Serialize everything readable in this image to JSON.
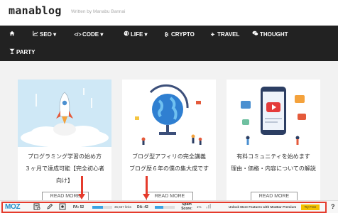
{
  "site": {
    "logo": "manablog",
    "tagline": "Written by Manabu Bannai"
  },
  "nav": {
    "items": [
      {
        "icon": "home-icon",
        "label": ""
      },
      {
        "icon": "chart-icon",
        "label": "SEO ▾"
      },
      {
        "icon": "code-icon",
        "label": "CODE ▾"
      },
      {
        "icon": "globe-icon",
        "label": "LIFE ▾"
      },
      {
        "icon": "bitcoin-icon",
        "label": "CRYPTO"
      },
      {
        "icon": "plane-icon",
        "label": "TRAVEL"
      },
      {
        "icon": "chat-icon",
        "label": "THOUGHT"
      },
      {
        "icon": "cocktail-icon",
        "label": "PARTY"
      }
    ]
  },
  "cards": [
    {
      "line1": "プログラミング学習の始め方",
      "line2": "３ヶ月で達成可能【完全初心者",
      "line3": "向け】",
      "more": "READ MORE",
      "thumb": "rocket-illustration"
    },
    {
      "line1": "ブログ型アフィリの完全講義",
      "line2": "ブログ歴６年の僕の集大成です",
      "line3": "",
      "more": "READ MORE",
      "thumb": "globe-illustration"
    },
    {
      "line1": "有料コミュニティを始めます",
      "line2": "理由・価格・内容についての解説",
      "line3": "",
      "more": "READ MORE",
      "thumb": "smartphone-video-illustration"
    }
  ],
  "mozbar": {
    "logo": "MOZ",
    "pa_label": "PA: 52",
    "pa_value": 52,
    "links": "36,557 links",
    "da_label": "DA: 42",
    "da_value": 42,
    "spam_label": "Spam Score:",
    "spam_value": "1%",
    "promo": "Unlock More Features with MozBar Premium",
    "try_label": "Try Free",
    "help": "?"
  },
  "colors": {
    "nav_bg": "#222222",
    "moz_blue": "#1d8cc9",
    "annotation_red": "#e53b2c",
    "try_yellow": "#f2c100"
  }
}
